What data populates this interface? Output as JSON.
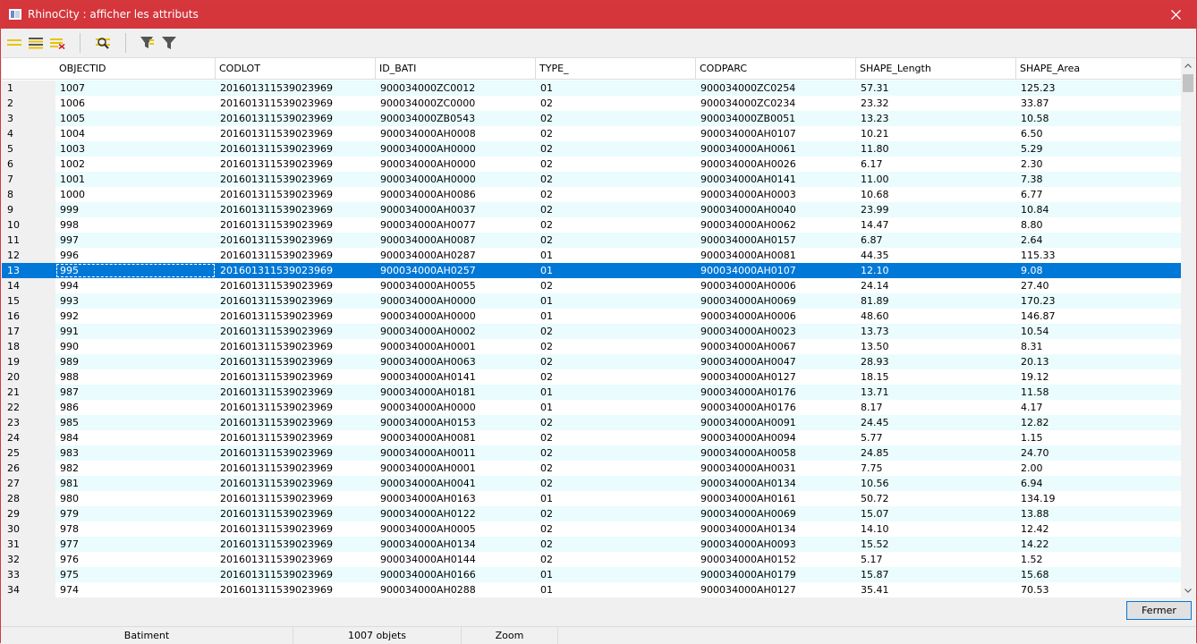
{
  "window": {
    "title": "RhinoCity : afficher les attributs",
    "close_glyph": "✕"
  },
  "toolbar": {
    "buttons": [
      {
        "name": "select-all-icon"
      },
      {
        "name": "invert-selection-icon"
      },
      {
        "name": "clear-selection-icon"
      },
      {
        "name": "zoom-to-selection-icon"
      },
      {
        "name": "filter-selection-icon"
      },
      {
        "name": "filter-icon"
      }
    ]
  },
  "table": {
    "columns": [
      "OBJECTID",
      "CODLOT",
      "ID_BATI",
      "TYPE_",
      "CODPARC",
      "SHAPE_Length",
      "SHAPE_Area"
    ],
    "selected_row_index": 12,
    "rows": [
      [
        "1",
        "1007",
        "201601311539023969",
        "900034000ZC0012",
        "01",
        "900034000ZC0254",
        "57.31",
        "125.23"
      ],
      [
        "2",
        "1006",
        "201601311539023969",
        "900034000ZC0000",
        "02",
        "900034000ZC0234",
        "23.32",
        "33.87"
      ],
      [
        "3",
        "1005",
        "201601311539023969",
        "900034000ZB0543",
        "02",
        "900034000ZB0051",
        "13.23",
        "10.58"
      ],
      [
        "4",
        "1004",
        "201601311539023969",
        "900034000AH0008",
        "02",
        "900034000AH0107",
        "10.21",
        "6.50"
      ],
      [
        "5",
        "1003",
        "201601311539023969",
        "900034000AH0000",
        "02",
        "900034000AH0061",
        "11.80",
        "5.29"
      ],
      [
        "6",
        "1002",
        "201601311539023969",
        "900034000AH0000",
        "02",
        "900034000AH0026",
        "6.17",
        "2.30"
      ],
      [
        "7",
        "1001",
        "201601311539023969",
        "900034000AH0000",
        "02",
        "900034000AH0141",
        "11.00",
        "7.38"
      ],
      [
        "8",
        "1000",
        "201601311539023969",
        "900034000AH0086",
        "02",
        "900034000AH0003",
        "10.68",
        "6.77"
      ],
      [
        "9",
        "999",
        "201601311539023969",
        "900034000AH0037",
        "02",
        "900034000AH0040",
        "23.99",
        "10.84"
      ],
      [
        "10",
        "998",
        "201601311539023969",
        "900034000AH0077",
        "02",
        "900034000AH0062",
        "14.47",
        "8.80"
      ],
      [
        "11",
        "997",
        "201601311539023969",
        "900034000AH0087",
        "02",
        "900034000AH0157",
        "6.87",
        "2.64"
      ],
      [
        "12",
        "996",
        "201601311539023969",
        "900034000AH0287",
        "01",
        "900034000AH0081",
        "44.35",
        "115.33"
      ],
      [
        "13",
        "995",
        "201601311539023969",
        "900034000AH0257",
        "01",
        "900034000AH0107",
        "12.10",
        "9.08"
      ],
      [
        "14",
        "994",
        "201601311539023969",
        "900034000AH0055",
        "02",
        "900034000AH0006",
        "24.14",
        "27.40"
      ],
      [
        "15",
        "993",
        "201601311539023969",
        "900034000AH0000",
        "01",
        "900034000AH0069",
        "81.89",
        "170.23"
      ],
      [
        "16",
        "992",
        "201601311539023969",
        "900034000AH0000",
        "01",
        "900034000AH0006",
        "48.60",
        "146.87"
      ],
      [
        "17",
        "991",
        "201601311539023969",
        "900034000AH0002",
        "02",
        "900034000AH0023",
        "13.73",
        "10.54"
      ],
      [
        "18",
        "990",
        "201601311539023969",
        "900034000AH0001",
        "02",
        "900034000AH0067",
        "13.50",
        "8.31"
      ],
      [
        "19",
        "989",
        "201601311539023969",
        "900034000AH0063",
        "02",
        "900034000AH0047",
        "28.93",
        "20.13"
      ],
      [
        "20",
        "988",
        "201601311539023969",
        "900034000AH0141",
        "02",
        "900034000AH0127",
        "18.15",
        "19.12"
      ],
      [
        "21",
        "987",
        "201601311539023969",
        "900034000AH0181",
        "01",
        "900034000AH0176",
        "13.71",
        "11.58"
      ],
      [
        "22",
        "986",
        "201601311539023969",
        "900034000AH0000",
        "01",
        "900034000AH0176",
        "8.17",
        "4.17"
      ],
      [
        "23",
        "985",
        "201601311539023969",
        "900034000AH0153",
        "02",
        "900034000AH0091",
        "24.45",
        "12.82"
      ],
      [
        "24",
        "984",
        "201601311539023969",
        "900034000AH0081",
        "02",
        "900034000AH0094",
        "5.77",
        "1.15"
      ],
      [
        "25",
        "983",
        "201601311539023969",
        "900034000AH0011",
        "02",
        "900034000AH0058",
        "24.85",
        "24.70"
      ],
      [
        "26",
        "982",
        "201601311539023969",
        "900034000AH0001",
        "02",
        "900034000AH0031",
        "7.75",
        "2.00"
      ],
      [
        "27",
        "981",
        "201601311539023969",
        "900034000AH0041",
        "02",
        "900034000AH0134",
        "10.56",
        "6.94"
      ],
      [
        "28",
        "980",
        "201601311539023969",
        "900034000AH0163",
        "01",
        "900034000AH0161",
        "50.72",
        "134.19"
      ],
      [
        "29",
        "979",
        "201601311539023969",
        "900034000AH0122",
        "02",
        "900034000AH0069",
        "15.07",
        "13.88"
      ],
      [
        "30",
        "978",
        "201601311539023969",
        "900034000AH0005",
        "02",
        "900034000AH0134",
        "14.10",
        "12.42"
      ],
      [
        "31",
        "977",
        "201601311539023969",
        "900034000AH0134",
        "02",
        "900034000AH0093",
        "15.52",
        "14.22"
      ],
      [
        "32",
        "976",
        "201601311539023969",
        "900034000AH0144",
        "02",
        "900034000AH0152",
        "5.17",
        "1.52"
      ],
      [
        "33",
        "975",
        "201601311539023969",
        "900034000AH0166",
        "01",
        "900034000AH0179",
        "15.87",
        "15.68"
      ],
      [
        "34",
        "974",
        "201601311539023969",
        "900034000AH0288",
        "01",
        "900034000AH0127",
        "35.41",
        "70.53"
      ]
    ]
  },
  "footer": {
    "close_label": "Fermer"
  },
  "status": {
    "layer": "Batiment",
    "count": "1007 objets",
    "mode": "Zoom"
  },
  "colors": {
    "titlebar": "#d4363c",
    "selection": "#0078d7",
    "alt_row": "#eafcfd"
  }
}
